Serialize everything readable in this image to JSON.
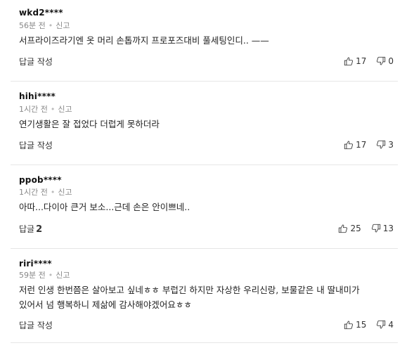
{
  "comments": [
    {
      "author": "wkd2****",
      "time": "56분 전",
      "report": "신고",
      "text": "서프라이즈라기엔 옷 머리 손톱까지 프로포즈대비 풀세팅인디.. ——",
      "reply_label": "답글 작성",
      "reply_count": "",
      "likes": "17",
      "dislikes": "0"
    },
    {
      "author": "hihi****",
      "time": "1시간 전",
      "report": "신고",
      "text": "연기생활은 잘 접었다 더럽게 못하더라",
      "reply_label": "답글 작성",
      "reply_count": "",
      "likes": "17",
      "dislikes": "3"
    },
    {
      "author": "ppob****",
      "time": "1시간 전",
      "report": "신고",
      "text": "아따...다이아 큰거 보소...근데 손은 안이쁘네..",
      "reply_label": "답글",
      "reply_count": "2",
      "likes": "25",
      "dislikes": "13"
    },
    {
      "author": "riri****",
      "time": "59분 전",
      "report": "신고",
      "text": "저런 인생 한번쯤은 살아보고 싶네ㅎㅎ 부럽긴 하지만 자상한 우리신랑, 보물같은 내 딸내미가\n있어서 넘 행복하니 제삶에 감사해야겠어요ㅎㅎ",
      "reply_label": "답글 작성",
      "reply_count": "",
      "likes": "15",
      "dislikes": "4"
    }
  ],
  "icons": {
    "like": "thumbs-up-icon",
    "dislike": "thumbs-down-icon"
  }
}
